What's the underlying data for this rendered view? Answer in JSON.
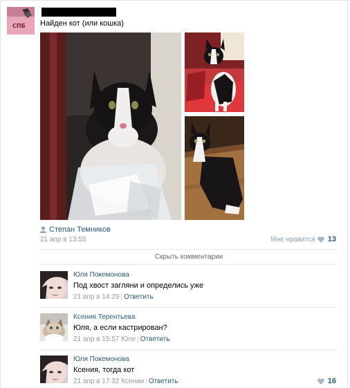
{
  "post": {
    "text": "Найден кот (или кошка)",
    "author": "Степан Темников",
    "date": "21 апр в 13:55",
    "like_label": "Мне нравится",
    "like_count": "13",
    "group_avatar_text": "СПБ"
  },
  "hide_comments": "Скрыть комментарии",
  "comments": [
    {
      "name": "Юля Покемонова",
      "text": "Под хвост загляни и определись уже",
      "date": "21 апр в 14:29",
      "reply_to": "",
      "reply_label": "Ответить",
      "likes": ""
    },
    {
      "name": "Ксения Терентьева",
      "text": "Юля, а если кастрирован?",
      "date": "21 апр в 15:57",
      "reply_to": "Юле",
      "reply_label": "Ответить",
      "likes": ""
    },
    {
      "name": "Юля Покемонова",
      "text": "Ксения, тогда кот",
      "date": "21 апр в 17:32",
      "reply_to": "Ксении",
      "reply_label": "Ответить",
      "likes": "16"
    }
  ],
  "colors": {
    "link": "#2b587a",
    "muted": "#999999",
    "like_heart": "#a3b5c8"
  },
  "icons": [
    "person-icon",
    "heart-icon"
  ]
}
